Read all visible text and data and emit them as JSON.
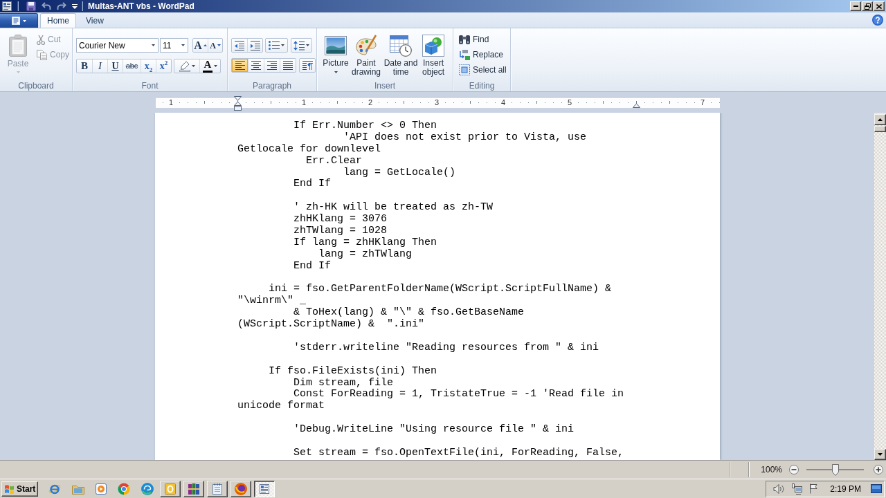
{
  "window": {
    "title": "Multas-ANT vbs - WordPad"
  },
  "ribbon": {
    "tabs": [
      {
        "label": "Home",
        "selected": true
      },
      {
        "label": "View",
        "selected": false
      }
    ],
    "clipboard": {
      "label": "Clipboard",
      "paste": {
        "label": "Paste",
        "disabled": true
      },
      "cut": {
        "label": "Cut",
        "disabled": true
      },
      "copy": {
        "label": "Copy",
        "disabled": true
      }
    },
    "font": {
      "label": "Font",
      "family": "Courier New",
      "size": "11",
      "size_buttons": [
        {
          "kind": "grow",
          "glyph": "A"
        },
        {
          "kind": "shrink",
          "glyph": "A"
        }
      ],
      "format_buttons": [
        {
          "kind": "bold",
          "glyph": "B"
        },
        {
          "kind": "italic",
          "glyph": "I"
        },
        {
          "kind": "underline",
          "glyph": "U"
        },
        {
          "kind": "strikethrough",
          "glyph": "abc"
        },
        {
          "kind": "subscript",
          "glyph": "x$_{2}$"
        },
        {
          "kind": "superscript",
          "glyph": "x$^{2}$"
        }
      ],
      "text_color": {
        "glyph": "A"
      }
    },
    "paragraph": {
      "label": "Paragraph",
      "alignment": [
        {
          "kind": "left",
          "selected": true
        },
        {
          "kind": "center",
          "selected": false
        },
        {
          "kind": "right",
          "selected": false
        },
        {
          "kind": "justify",
          "selected": false
        }
      ]
    },
    "insert": {
      "label": "Insert",
      "items": [
        {
          "kind": "picture",
          "label": "Picture"
        },
        {
          "kind": "paint",
          "label": "Paint\ndrawing"
        },
        {
          "kind": "datetime",
          "label": "Date and\ntime"
        },
        {
          "kind": "object",
          "label": "Insert\nobject"
        }
      ]
    },
    "editing": {
      "label": "Editing",
      "items": [
        {
          "kind": "find",
          "label": "Find"
        },
        {
          "kind": "replace",
          "label": "Replace"
        },
        {
          "kind": "select_all",
          "label": "Select all"
        }
      ]
    }
  },
  "ruler": {
    "labels": [
      "1",
      "1",
      "2",
      "3",
      "4",
      "5",
      "7"
    ]
  },
  "document": {
    "blocks": [
      {
        "lines": [
          "         If Err.Number <> 0 Then",
          "                 'API does not exist prior to Vista, use",
          "Getlocale for downlevel",
          "           Err.Clear",
          "                 lang = GetLocale()",
          "         End If"
        ]
      },
      {
        "lines": [
          "         ' zh-HK will be treated as zh-TW",
          "         zhHKlang = 3076",
          "         zhTWlang = 1028",
          "         If lang = zhHKlang Then",
          "             lang = zhTWlang",
          "         End If"
        ]
      },
      {
        "lines": [
          "     ini = fso.GetParentFolderName(WScript.ScriptFullName) &",
          "\"\\winrm\\\" _",
          "         & ToHex(lang) & \"\\\" & fso.GetBaseName",
          "(WScript.ScriptName) &  \".ini\""
        ]
      },
      {
        "lines": [
          "         'stderr.writeline \"Reading resources from \" & ini"
        ]
      },
      {
        "lines": [
          "     If fso.FileExists(ini) Then",
          "         Dim stream, file",
          "         Const ForReading = 1, TristateTrue = -1 'Read file in",
          "unicode format"
        ]
      },
      {
        "lines": [
          "         'Debug.WriteLine \"Using resource file \" & ini"
        ]
      },
      {
        "lines": [
          "         Set stream = fso.OpenTextFile(ini, ForReading, False,"
        ]
      }
    ]
  },
  "status_bar": {
    "zoom": "100%",
    "zoom_slider": {
      "level": 0.5
    }
  },
  "taskbar": {
    "start": "Start",
    "tasks": [
      {
        "kind": "ring_tile",
        "selected": false
      },
      {
        "kind": "books",
        "selected": false
      },
      {
        "kind": "notepad",
        "selected": false
      },
      {
        "kind": "globe",
        "selected": false
      },
      {
        "kind": "document",
        "selected": true
      }
    ],
    "clock": "2:19 PM"
  }
}
